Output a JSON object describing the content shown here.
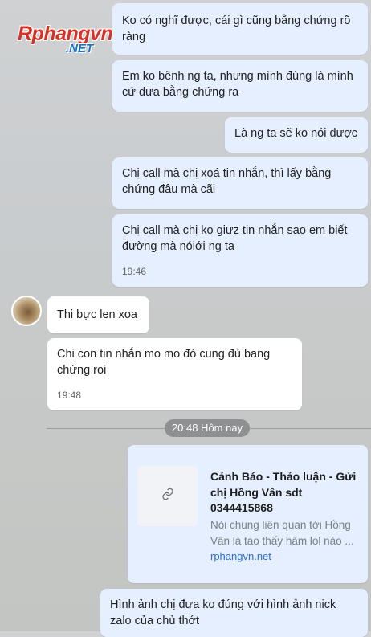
{
  "colors": {
    "mine_bubble": "#e5efff",
    "their_bubble": "#ffffff",
    "divider_pill": "#8e9092",
    "link": "#2a6fd4"
  },
  "watermark": {
    "main": "Rphangvn",
    "sub": ".NET"
  },
  "messages": {
    "m1": "Ko có nghĩ được, cái gì cũng bằng chứng rõ ràng",
    "m2": "Em ko bênh ng ta, nhưng mình đúng là mình cứ đưa bằng chứng ra",
    "m3": "Là ng ta sẽ ko nói được",
    "m4": "Chị call mà chị xoá tin nhắn, thì lấy bằng chứng đâu mà cãi",
    "m5": "Chị call mà chị ko giưz tin nhắn sao em biết đường mà nóiới ng ta",
    "m5_time": "19:46",
    "t1": "Thi bực len xoa",
    "t2": "Chi con tin nhắn mo mo đó cung đủ bang chứng roi",
    "t2_time": "19:48",
    "divider": "20:48 Hôm nay",
    "link_title": "Cảnh Báo - Thảo luận - Gửi chị Hồng Vân sdt 0344415868",
    "link_desc": "Nói chung liên quan tới Hồng Vân là tao thấy hãm lol nào ...",
    "link_domain": "rphangvn.net",
    "m6": "Hình ảnh chị đưa ko đúng với hình ảnh nick zalo của chủ thớt"
  }
}
